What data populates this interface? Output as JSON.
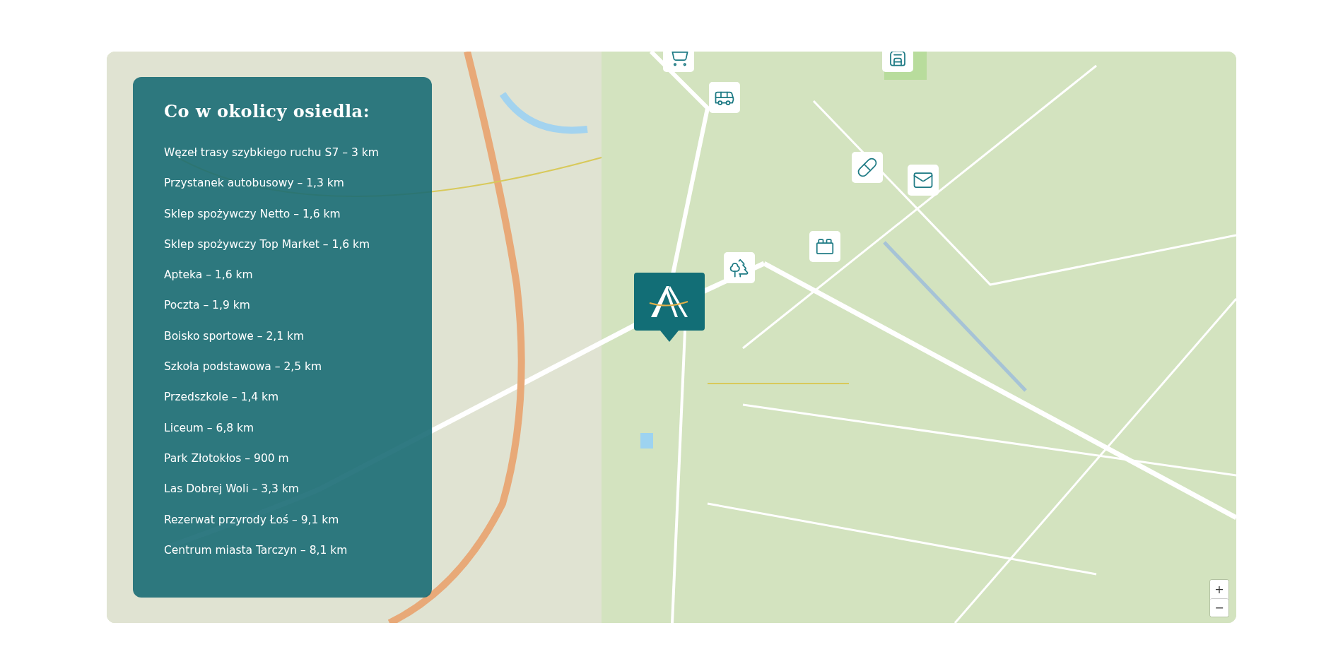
{
  "panel": {
    "title": "Co w okolicy osiedla:",
    "items": [
      "Węzeł trasy szybkiego ruchu S7 – 3 km",
      "Przystanek autobusowy – 1,3 km",
      "Sklep spożywczy Netto – 1,6 km",
      "Sklep spożywczy Top Market – 1,6 km",
      "Apteka – 1,6 km",
      "Poczta – 1,9 km",
      "Boisko sportowe – 2,1 km",
      "Szkoła podstawowa – 2,5 km",
      "Przedszkole – 1,4 km",
      "Liceum – 6,8 km",
      "Park Złotokłos – 900 m",
      "Las Dobrej Woli – 3,3 km",
      "Rezerwat przyrody Łoś – 9,1 km",
      "Centrum miasta Tarczyn – 8,1 km"
    ]
  },
  "zoom_controls": {
    "zoom_in": "+",
    "zoom_out": "−"
  }
}
